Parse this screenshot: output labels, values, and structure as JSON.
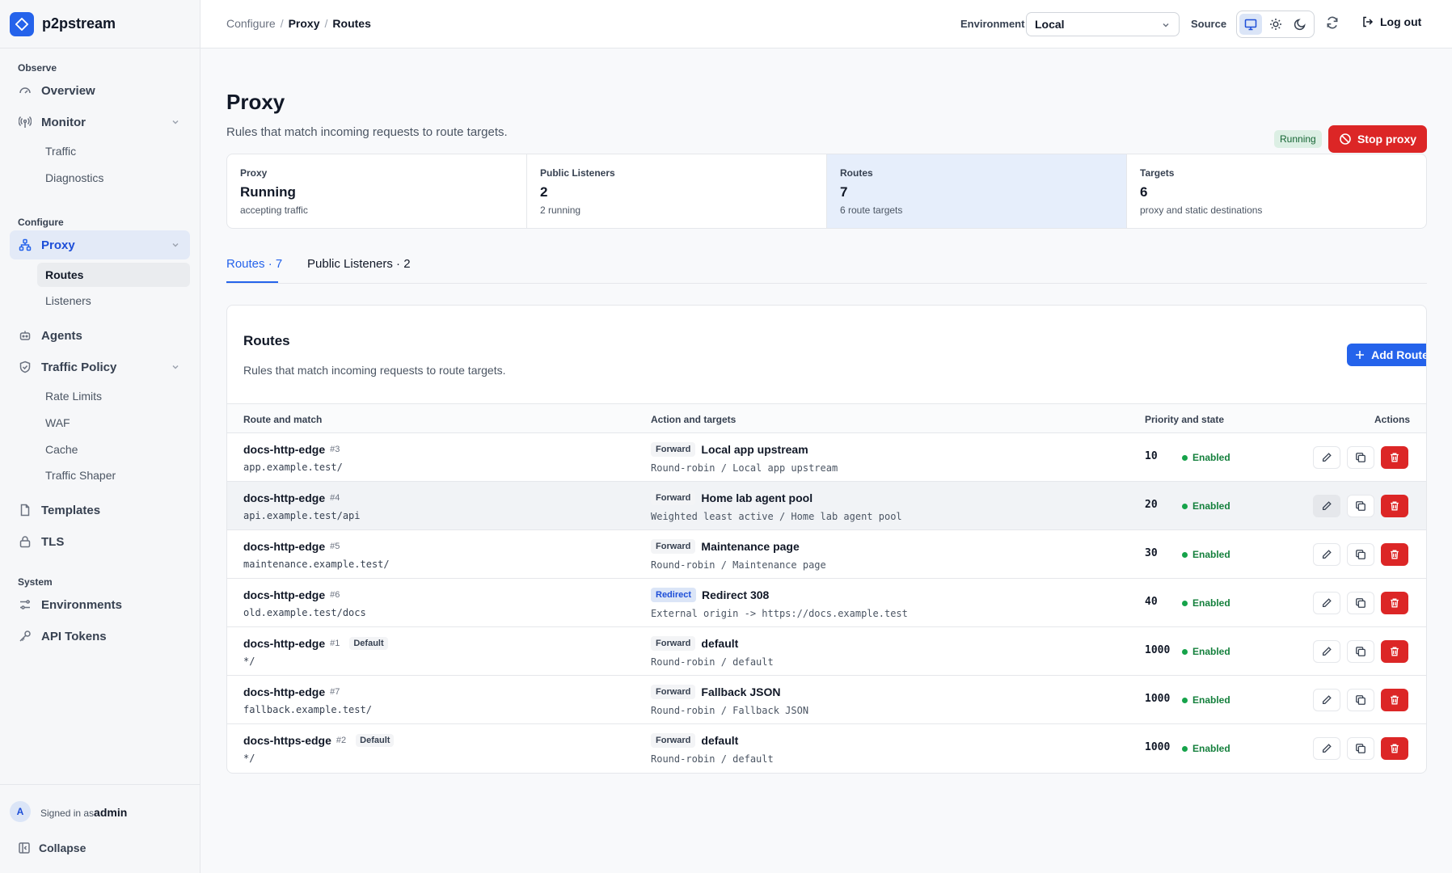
{
  "app": {
    "name": "p2pstream",
    "colors": {
      "accent": "#2563eb",
      "danger": "#dc2626",
      "success": "#16a34a"
    }
  },
  "sidebar": {
    "sections": {
      "observe": "Observe",
      "configure": "Configure",
      "system": "System"
    },
    "items": {
      "overview": "Overview",
      "monitor": "Monitor",
      "traffic": "Traffic",
      "diagnostics": "Diagnostics",
      "proxy": "Proxy",
      "routes": "Routes",
      "listeners": "Listeners",
      "agents": "Agents",
      "traffic_policy": "Traffic Policy",
      "rate_limits": "Rate Limits",
      "waf": "WAF",
      "cache": "Cache",
      "traffic_shaper": "Traffic Shaper",
      "templates": "Templates",
      "tls": "TLS",
      "environments": "Environments",
      "api_tokens": "API Tokens"
    },
    "footer": {
      "avatar": "A",
      "signed_in_prefix": "Signed in as",
      "username": "admin",
      "collapse": "Collapse"
    }
  },
  "topbar": {
    "breadcrumb": [
      "Configure",
      "Proxy",
      "Routes"
    ],
    "environment_label": "Environment",
    "environment_value": "Local",
    "source_label": "Source",
    "source_options": [
      "monitor-icon",
      "sun-icon",
      "moon-icon"
    ],
    "source_selected": "monitor-icon",
    "logout": "Log out"
  },
  "page": {
    "title": "Proxy",
    "subtitle": "Rules that match incoming requests to route targets.",
    "status_badge": "Running",
    "stop_button": "Stop proxy",
    "stats": [
      {
        "label": "Proxy",
        "value": "Running",
        "note": "accepting traffic"
      },
      {
        "label": "Public Listeners",
        "value": "2",
        "note": "2 running"
      },
      {
        "label": "Routes",
        "value": "7",
        "note": "6 route targets"
      },
      {
        "label": "Targets",
        "value": "6",
        "note": "proxy and static destinations"
      }
    ],
    "tabs": [
      "Routes · 7",
      "Public Listeners · 2"
    ]
  },
  "routes_card": {
    "title": "Routes",
    "subtitle": "Rules that match incoming requests to route targets.",
    "add_button": "Add Route",
    "columns": [
      "Route and match",
      "Action and targets",
      "Priority and state",
      "Actions"
    ],
    "rows": [
      {
        "name": "docs-http-edge",
        "id": "#3",
        "default": "",
        "match": "app.example.test/",
        "kind": "Forward",
        "target": "Local app upstream",
        "desc": "Round-robin / Local app upstream",
        "priority": "10",
        "state": "Enabled"
      },
      {
        "name": "docs-http-edge",
        "id": "#4",
        "default": "",
        "match": "api.example.test/api",
        "kind": "Forward",
        "target": "Home lab agent pool",
        "desc": "Weighted least active / Home lab agent pool",
        "priority": "20",
        "state": "Enabled"
      },
      {
        "name": "docs-http-edge",
        "id": "#5",
        "default": "",
        "match": "maintenance.example.test/",
        "kind": "Forward",
        "target": "Maintenance page",
        "desc": "Round-robin / Maintenance page",
        "priority": "30",
        "state": "Enabled"
      },
      {
        "name": "docs-http-edge",
        "id": "#6",
        "default": "",
        "match": "old.example.test/docs",
        "kind": "Redirect",
        "target": "Redirect 308",
        "desc": "External origin -> https://docs.example.test",
        "priority": "40",
        "state": "Enabled"
      },
      {
        "name": "docs-http-edge",
        "id": "#1",
        "default": "Default",
        "match": "*/",
        "kind": "Forward",
        "target": "default",
        "desc": "Round-robin / default",
        "priority": "1000",
        "state": "Enabled"
      },
      {
        "name": "docs-http-edge",
        "id": "#7",
        "default": "",
        "match": "fallback.example.test/",
        "kind": "Forward",
        "target": "Fallback JSON",
        "desc": "Round-robin / Fallback JSON",
        "priority": "1000",
        "state": "Enabled"
      },
      {
        "name": "docs-https-edge",
        "id": "#2",
        "default": "Default",
        "match": "*/",
        "kind": "Forward",
        "target": "default",
        "desc": "Round-robin / default",
        "priority": "1000",
        "state": "Enabled"
      }
    ]
  }
}
